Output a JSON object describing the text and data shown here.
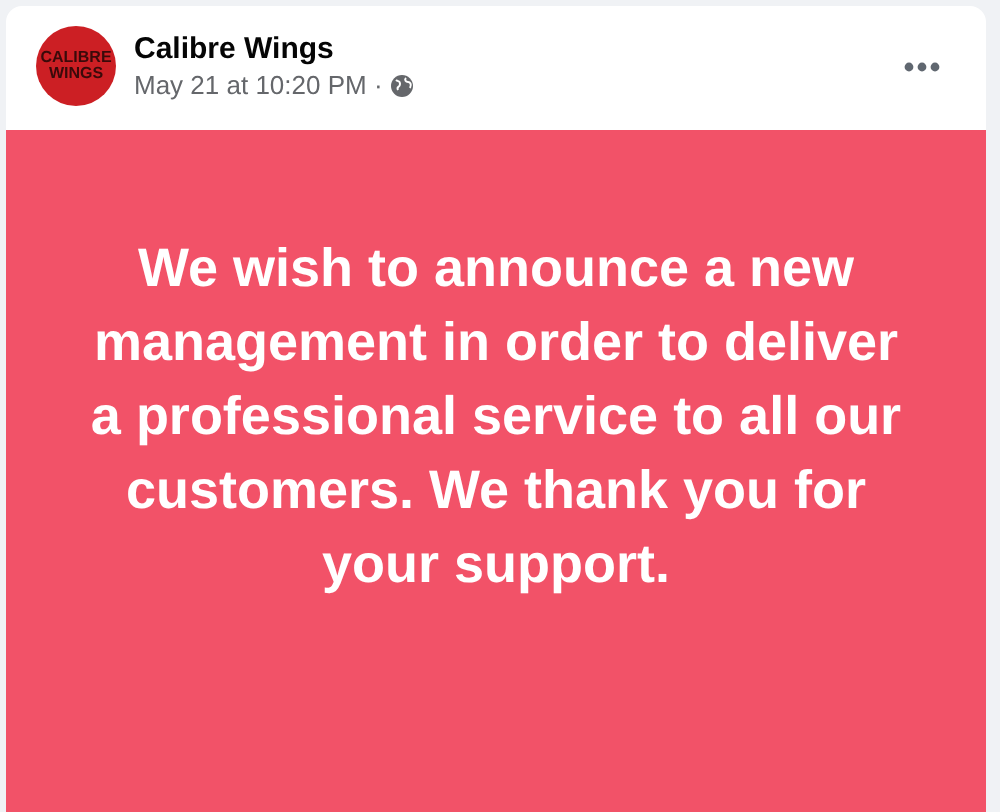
{
  "post": {
    "avatar": {
      "line_1": "CALIBRE",
      "line_2": "WINGS"
    },
    "author": "Calibre Wings",
    "timestamp": "May 21 at 10:20 PM ·",
    "message": "We wish to announce a new management in order to deliver a professional service to all our customers. We thank you for your support."
  }
}
